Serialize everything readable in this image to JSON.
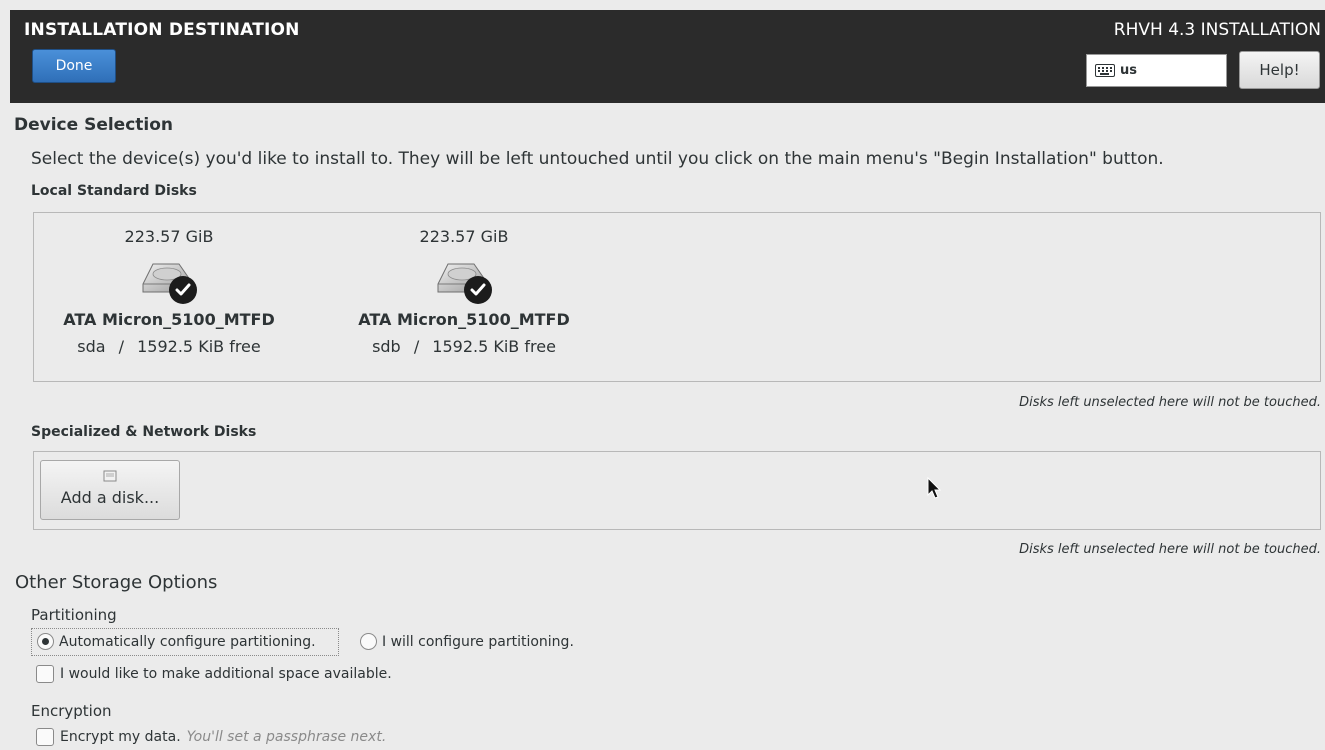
{
  "header": {
    "title": "INSTALLATION DESTINATION",
    "done_label": "Done",
    "product": "RHVH 4.3 INSTALLATION",
    "keyboard_layout": "us",
    "help_label": "Help!"
  },
  "device_selection": {
    "heading": "Device Selection",
    "description": "Select the device(s) you'd like to install to.  They will be left untouched until you click on the main menu's \"Begin Installation\" button.",
    "local_heading": "Local Standard Disks",
    "disks": [
      {
        "size": "223.57 GiB",
        "name": "ATA Micron_5100_MTFD",
        "dev": "sda",
        "free": "1592.5 KiB free",
        "selected": true
      },
      {
        "size": "223.57 GiB",
        "name": "ATA Micron_5100_MTFD",
        "dev": "sdb",
        "free": "1592.5 KiB free",
        "selected": true
      }
    ],
    "local_note": "Disks left unselected here will not be touched.",
    "specialized_heading": "Specialized & Network Disks",
    "add_disk_label": "Add a disk...",
    "specialized_note": "Disks left unselected here will not be touched."
  },
  "other_storage": {
    "heading": "Other Storage Options",
    "partitioning_heading": "Partitioning",
    "auto_label": "Automatically configure partitioning.",
    "manual_label": "I will configure partitioning.",
    "selected_option": "auto",
    "space_label": "I would like to make additional space available.",
    "encryption_heading": "Encryption",
    "encrypt_label": "Encrypt my data.",
    "encrypt_hint": "You'll set a passphrase next."
  },
  "colors": {
    "header_bg": "#2b2b2b",
    "done_button": "#3a7fc8",
    "page_bg": "#ebebeb"
  },
  "icons": [
    "keyboard-icon",
    "hard-disk-icon",
    "checkmark-icon",
    "add-disk-icon",
    "mouse-pointer-icon"
  ]
}
